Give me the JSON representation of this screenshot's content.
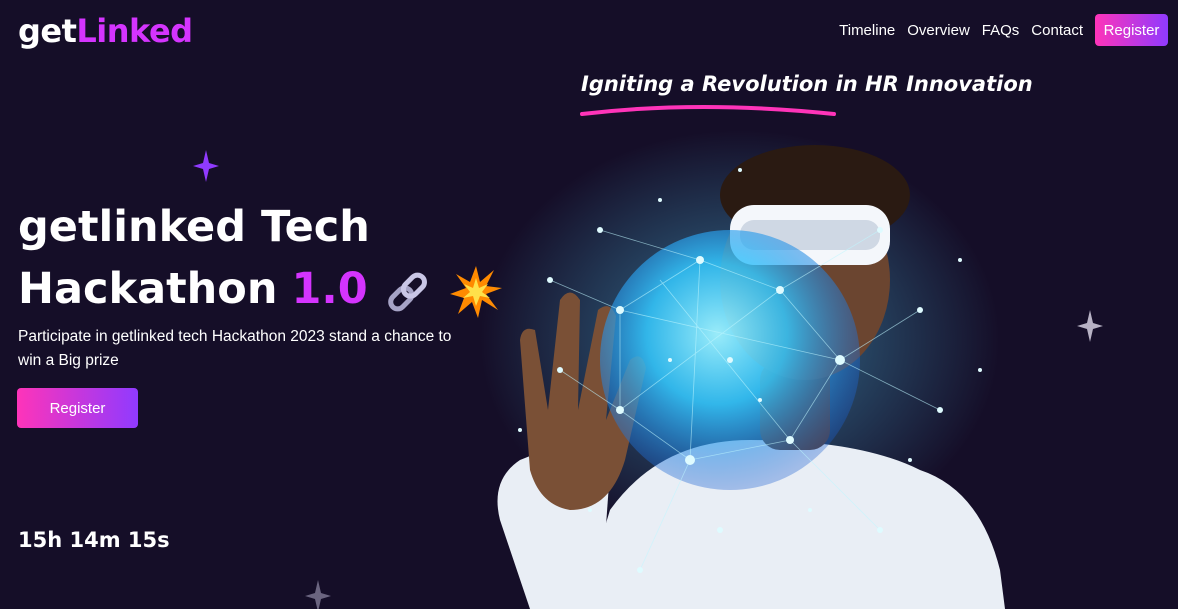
{
  "header": {
    "logo_part1": "get",
    "logo_part2": "Linked",
    "nav": [
      "Timeline",
      "Overview",
      "FAQs",
      "Contact"
    ],
    "register_label": "Register"
  },
  "tagline": "Igniting a Revolution in HR Innovation",
  "hero": {
    "title_line1": "getlinked Tech",
    "title_line2": "Hackathon",
    "version": "1.0",
    "description": "Participate in getlinked tech Hackathon 2023 stand a chance to win a Big prize",
    "register_label": "Register",
    "countdown": "15h 14m 15s"
  },
  "colors": {
    "background": "#150e28",
    "accent": "#d434fe",
    "gradient_start": "#fe34b9",
    "gradient_end": "#903aff"
  },
  "icons": [
    "link-chain-icon",
    "collision-icon",
    "sparkle-star-icon"
  ]
}
